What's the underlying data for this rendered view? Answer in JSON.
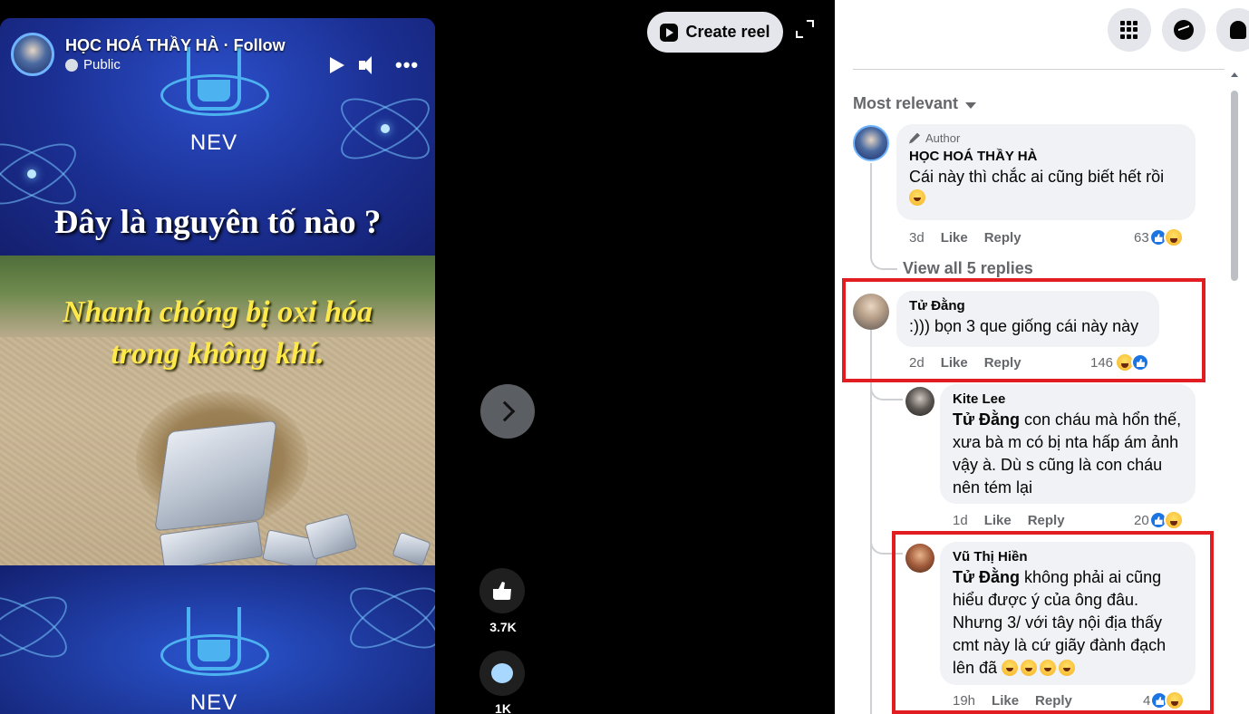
{
  "video": {
    "page_name": "HỌC HOÁ THẦY HÀ · Follow",
    "privacy": "Public",
    "brand": "NEV",
    "brand_bottom": "NEV",
    "headline": "Đây là nguyên tố nào ?",
    "caption_line1": "Nhanh chóng bị oxi hóa",
    "caption_line2": "trong không khí."
  },
  "overlay": {
    "create_reel": "Create reel",
    "like_count": "3.7K",
    "comment_count": "1K"
  },
  "comments": {
    "sort_label": "Most relevant",
    "view_replies": "View all 5 replies",
    "like_label": "Like",
    "reply_label": "Reply",
    "items": [
      {
        "author_badge": "Author",
        "name": "HỌC HOÁ THẦY HÀ",
        "text": "Cái này thì chắc ai cũng biết hết rồi",
        "time": "3d",
        "reactions": "63"
      },
      {
        "name": "Tử Đằng",
        "text": ":))) bọn 3 que giống cái này này",
        "time": "2d",
        "reactions": "146"
      },
      {
        "name": "Kite Lee",
        "mention": "Tử Đằng",
        "text": " con cháu mà hổn thế, xưa bà m có bị nta hấp ám ảnh vậy à. Dù s cũng là con cháu nên tém lại",
        "time": "1d",
        "reactions": "20"
      },
      {
        "name": "Vũ Thị Hiền",
        "mention": "Tử Đằng",
        "text": " không phải ai cũng hiểu được ý của ông đâu. Nhưng 3/ với tây nội địa thấy cmt này là cứ giãy đành đạch lên đã",
        "time": "19h",
        "reactions": "4"
      }
    ]
  },
  "colors": {
    "highlight": "#e11d22",
    "bubble": "#f0f2f5",
    "muted_text": "#65676b",
    "like_blue": "#1b74e4",
    "caption_yellow": "#ffe94a"
  }
}
